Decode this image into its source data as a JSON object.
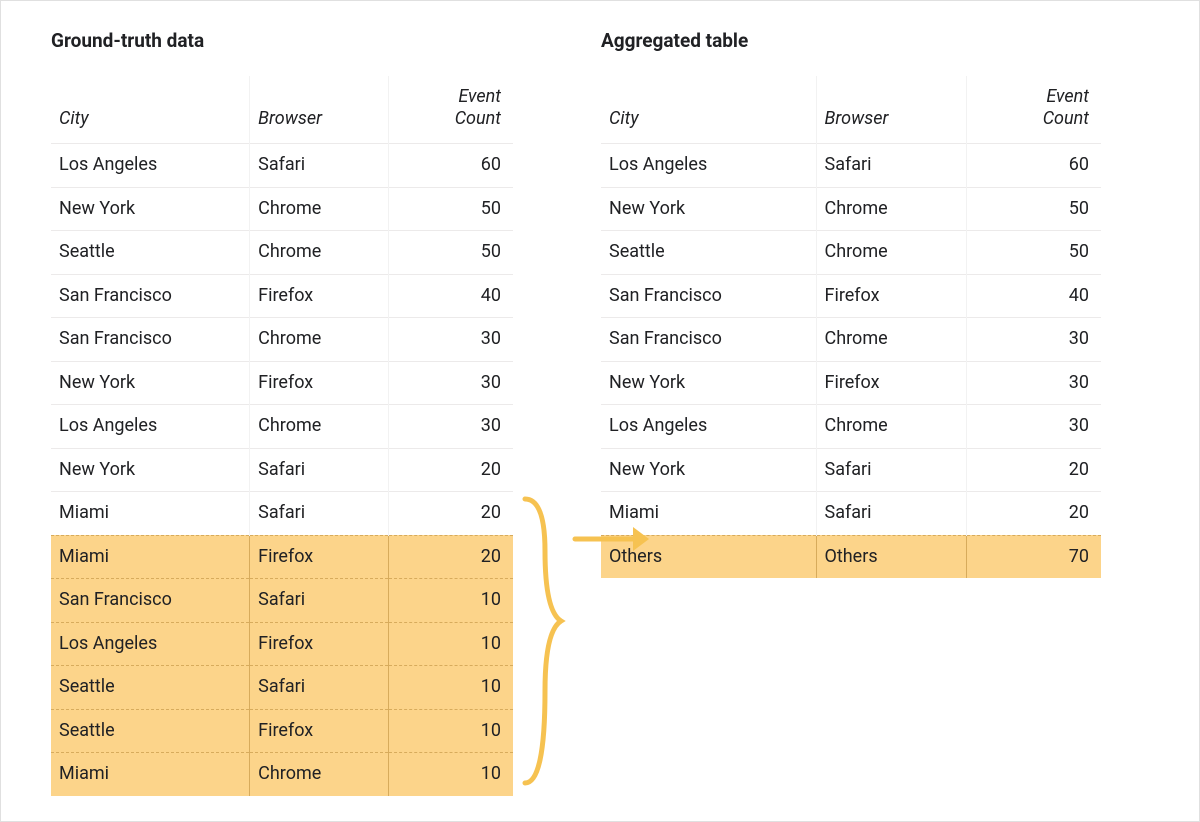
{
  "colors": {
    "highlight": "#fcd48a",
    "arrow": "#f6c251",
    "border": "#e0e0e0"
  },
  "left": {
    "title": "Ground-truth data",
    "columns": {
      "city": "City",
      "browser": "Browser",
      "event_count": "Event\nCount"
    },
    "rows": [
      {
        "city": "Los Angeles",
        "browser": "Safari",
        "event_count": 60,
        "highlight": false
      },
      {
        "city": "New York",
        "browser": "Chrome",
        "event_count": 50,
        "highlight": false
      },
      {
        "city": "Seattle",
        "browser": "Chrome",
        "event_count": 50,
        "highlight": false
      },
      {
        "city": "San Francisco",
        "browser": "Firefox",
        "event_count": 40,
        "highlight": false
      },
      {
        "city": "San Francisco",
        "browser": "Chrome",
        "event_count": 30,
        "highlight": false
      },
      {
        "city": "New York",
        "browser": "Firefox",
        "event_count": 30,
        "highlight": false
      },
      {
        "city": "Los Angeles",
        "browser": "Chrome",
        "event_count": 30,
        "highlight": false
      },
      {
        "city": "New York",
        "browser": "Safari",
        "event_count": 20,
        "highlight": false
      },
      {
        "city": "Miami",
        "browser": "Safari",
        "event_count": 20,
        "highlight": false
      },
      {
        "city": "Miami",
        "browser": "Firefox",
        "event_count": 20,
        "highlight": true
      },
      {
        "city": "San Francisco",
        "browser": "Safari",
        "event_count": 10,
        "highlight": true
      },
      {
        "city": "Los Angeles",
        "browser": "Firefox",
        "event_count": 10,
        "highlight": true
      },
      {
        "city": "Seattle",
        "browser": "Safari",
        "event_count": 10,
        "highlight": true
      },
      {
        "city": "Seattle",
        "browser": "Firefox",
        "event_count": 10,
        "highlight": true
      },
      {
        "city": "Miami",
        "browser": "Chrome",
        "event_count": 10,
        "highlight": true
      }
    ]
  },
  "right": {
    "title": "Aggregated table",
    "columns": {
      "city": "City",
      "browser": "Browser",
      "event_count": "Event\nCount"
    },
    "rows": [
      {
        "city": "Los Angeles",
        "browser": "Safari",
        "event_count": 60,
        "highlight": false
      },
      {
        "city": "New York",
        "browser": "Chrome",
        "event_count": 50,
        "highlight": false
      },
      {
        "city": "Seattle",
        "browser": "Chrome",
        "event_count": 50,
        "highlight": false
      },
      {
        "city": "San Francisco",
        "browser": "Firefox",
        "event_count": 40,
        "highlight": false
      },
      {
        "city": "San Francisco",
        "browser": "Chrome",
        "event_count": 30,
        "highlight": false
      },
      {
        "city": "New York",
        "browser": "Firefox",
        "event_count": 30,
        "highlight": false
      },
      {
        "city": "Los Angeles",
        "browser": "Chrome",
        "event_count": 30,
        "highlight": false
      },
      {
        "city": "New York",
        "browser": "Safari",
        "event_count": 20,
        "highlight": false
      },
      {
        "city": "Miami",
        "browser": "Safari",
        "event_count": 20,
        "highlight": false
      },
      {
        "city": "Others",
        "browser": "Others",
        "event_count": 70,
        "highlight": true
      }
    ]
  }
}
